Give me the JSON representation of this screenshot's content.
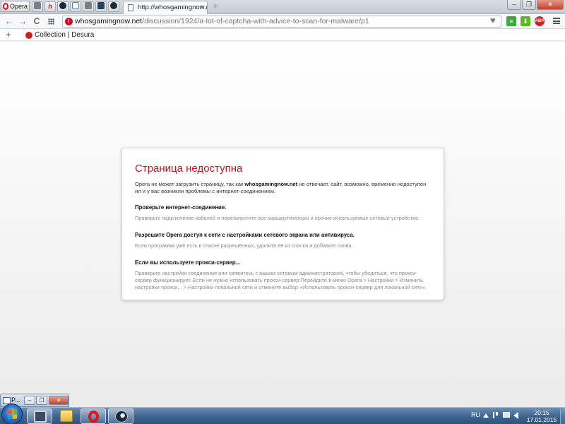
{
  "browser": {
    "menu_label": "Opera",
    "tab": {
      "title": "http://whosgamingnow.ne",
      "close_glyph": "×"
    },
    "newtab_glyph": "+",
    "window_buttons": {
      "minimize": "–",
      "restore": "❐",
      "close": "×"
    }
  },
  "navbar": {
    "back_glyph": "←",
    "forward_glyph": "→",
    "reload_glyph": "C",
    "url_host": "whosgamingnow.net",
    "url_path": "/discussion/1924/a-lot-of-captcha-with-advice-to-scan-for-malware/p1",
    "alert_glyph": "!",
    "heart_glyph": "♥",
    "extensions": [
      {
        "name": "speed-dial-ext",
        "glyph": "≡",
        "color": "#3aa83a"
      },
      {
        "name": "download-ext",
        "glyph": "⬇",
        "color": "#5bb81e"
      },
      {
        "name": "adblock-ext",
        "glyph": "ABP",
        "color": "#d32020"
      }
    ]
  },
  "bookmarks": {
    "add_glyph": "+",
    "items": [
      "Collection | Desura"
    ]
  },
  "error": {
    "title": "Страница недоступна",
    "lead_before": "Opera не может загрузить страницу, так как ",
    "lead_host": "whosgamingnow.net",
    "lead_after": " не отвечает. сайт, возможно, временно недоступен ил и у вас возникли проблемы с интернет-соединением.",
    "sections": [
      {
        "head": "Проверьте интернет-соединение.",
        "body": "Проверьте подключение кабелей и перезапустите все маршрутизаторы и прочие используемые сетевые устройства."
      },
      {
        "head": "Разрешите Opera доступ к сети с настройками сетевого экрана или антивируса.",
        "body": "Если программа уже есть в списке разрешённых, удалите её из списка и добавьте снова."
      },
      {
        "head": "Если вы используете прокси-сервер...",
        "body": "Проверьте настройки соединения или свяжитесь с вашим сетевым администратором, чтобы убедиться, что прокси-сервер функционирует. Если не нужно использовать прокси-сервер:Перейдите в меню Opera > Настройки > Изменить настройки прокси... > Настройки локальной сети и отмените выбор «Использовать прокси-сервер для локальной сети»."
      }
    ]
  },
  "taskbar": {
    "preview_title": "P...",
    "preview_buttons": {
      "min": "–",
      "restore": "❐",
      "close": "×"
    },
    "apps": [
      "computer",
      "explorer",
      "opera",
      "steam"
    ],
    "language": "RU",
    "time": "20:15",
    "date": "17.01.2015"
  },
  "colors": {
    "error_title": "#c8141e",
    "opera_red": "#e0131f",
    "taskbar": "#3f6591"
  }
}
